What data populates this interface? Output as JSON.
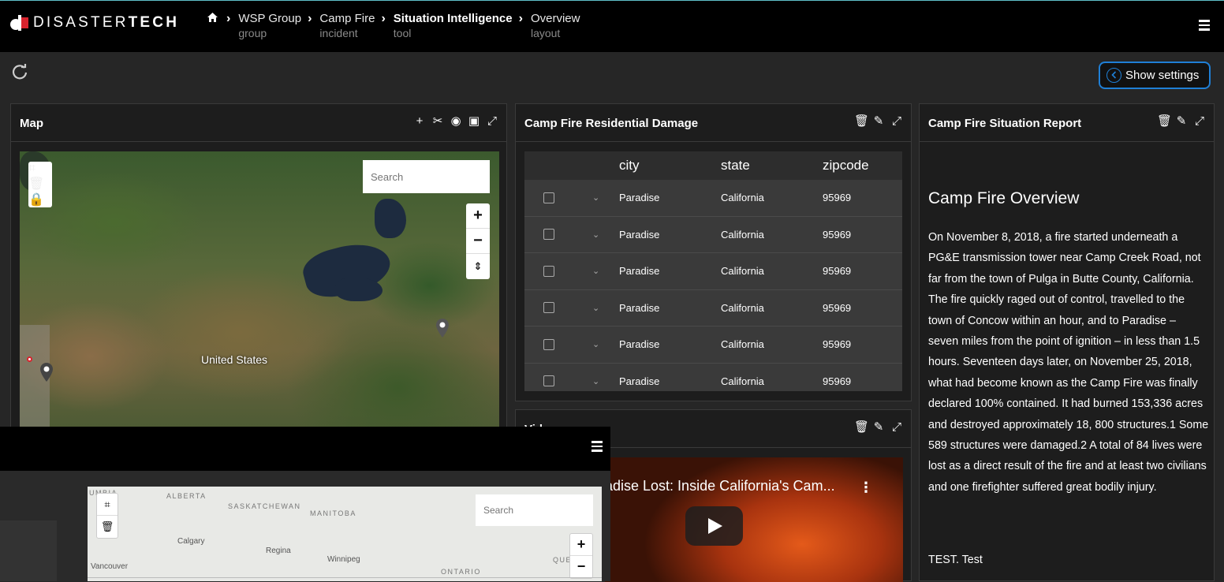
{
  "brand": {
    "name_light": "DISASTER",
    "name_bold": "TECH",
    "accent": "#d9232e"
  },
  "breadcrumbs": [
    {
      "label": "WSP Group",
      "sub": "group"
    },
    {
      "label": "Camp Fire",
      "sub": "incident"
    },
    {
      "label": "Situation Intelligence",
      "sub": "tool"
    },
    {
      "label": "Overview",
      "sub": "layout"
    }
  ],
  "toolbar": {
    "show_settings": "Show settings"
  },
  "map_panel": {
    "title": "Map",
    "search_placeholder": "Search",
    "country_label": "United States"
  },
  "damage_panel": {
    "title": "Camp Fire Residential Damage",
    "columns": [
      "city",
      "state",
      "zipcode"
    ],
    "rows": [
      {
        "city": "Paradise",
        "state": "California",
        "zipcode": "95969"
      },
      {
        "city": "Paradise",
        "state": "California",
        "zipcode": "95969"
      },
      {
        "city": "Paradise",
        "state": "California",
        "zipcode": "95969"
      },
      {
        "city": "Paradise",
        "state": "California",
        "zipcode": "95969"
      },
      {
        "city": "Paradise",
        "state": "California",
        "zipcode": "95969"
      },
      {
        "city": "Paradise",
        "state": "California",
        "zipcode": "95969"
      }
    ]
  },
  "video_panel": {
    "title": "Video",
    "video_title": "adise Lost: Inside California's Cam..."
  },
  "report_panel": {
    "title": "Camp Fire Situation Report",
    "heading": "Camp Fire Overview",
    "body": "On November 8, 2018, a fire started underneath a PG&E transmission tower near Camp Creek Road, not far from the town of Pulga in Butte County, California. The fire quickly raged out of control, travelled to the town of Concow within an hour, and to Paradise – seven miles from the point of ignition – in less than 1.5 hours. Seventeen days later, on November 25, 2018, what had become known as the Camp Fire was finally declared 100% contained. It had burned 153,336 acres and destroyed approximately 18, 800 structures.1 Some 589 structures were damaged.2 A total of 84 lives were lost as a direct result of the fire and at least two civilians and one firefighter suffered great bodily injury.",
    "footer": "TEST. Test"
  },
  "overlay_map": {
    "search_placeholder": "Search",
    "regions": [
      "UMBIA",
      "ALBERTA",
      "SASKATCHEWAN",
      "MANITOBA",
      "ONTARIO",
      "QUE"
    ],
    "cities": [
      "Calgary",
      "Regina",
      "Winnipeg",
      "Vancouver"
    ]
  }
}
